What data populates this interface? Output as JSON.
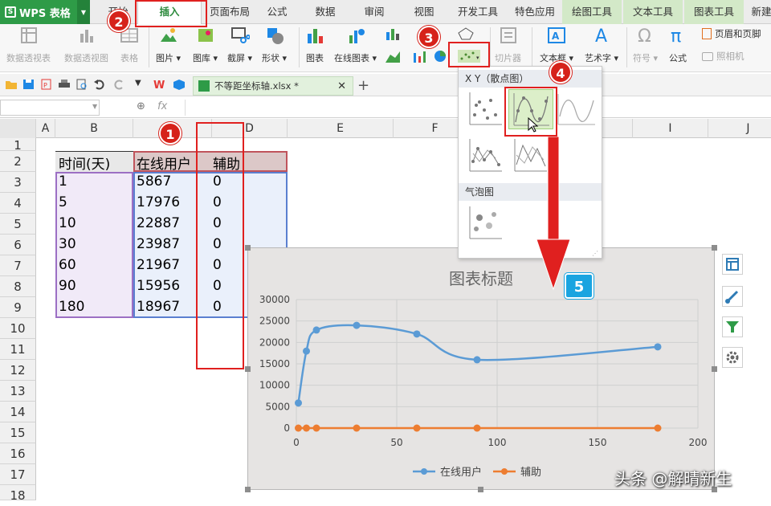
{
  "menubar": {
    "app_name": "WPS 表格",
    "tabs": [
      "开始",
      "插入",
      "页面布局",
      "公式",
      "数据",
      "审阅",
      "视图",
      "开发工具",
      "特色应用",
      "绘图工具",
      "文本工具",
      "图表工具",
      "新建"
    ],
    "active_tab": "插入"
  },
  "ribbon": {
    "pivot_table": "数据透视表",
    "pivot_chart": "数据透视图",
    "table": "表格",
    "picture": "图片",
    "gallery": "图库",
    "screenshot": "截屏",
    "shape": "形状",
    "chart": "图表",
    "online_chart": "在线图表",
    "slicer": "切片器",
    "textbox": "文本框",
    "wordart": "艺术字",
    "symbol": "符号",
    "formula": "公式",
    "header_footer": "页眉和页脚",
    "camera": "照相机"
  },
  "file": {
    "tab_name": "不等距坐标轴.xlsx *"
  },
  "formula_bar": {
    "fx": "fx"
  },
  "sheet": {
    "columns": [
      "A",
      "B",
      "C",
      "D",
      "E",
      "F",
      "G",
      "H",
      "I",
      "J"
    ],
    "rows": [
      "1",
      "2",
      "3",
      "4",
      "5",
      "6",
      "7",
      "8",
      "9",
      "10",
      "11",
      "12",
      "13",
      "14",
      "15",
      "16",
      "17",
      "18"
    ],
    "headers": [
      "时间(天)",
      "在线用户",
      "辅助"
    ],
    "data": [
      [
        "1",
        "5867",
        "0"
      ],
      [
        "5",
        "17976",
        "0"
      ],
      [
        "10",
        "22887",
        "0"
      ],
      [
        "30",
        "23987",
        "0"
      ],
      [
        "60",
        "21967",
        "0"
      ],
      [
        "90",
        "15956",
        "0"
      ],
      [
        "180",
        "18967",
        "0"
      ]
    ]
  },
  "dropdown": {
    "xy_section": "X Y（散点图）",
    "bubble_section": "气泡图"
  },
  "chart": {
    "title": "图表标题",
    "accent_blue": "#5b9bd5",
    "accent_orange": "#ed7d31"
  },
  "chart_data": {
    "type": "scatter",
    "title": "图表标题",
    "xlim": [
      0,
      200
    ],
    "ylim": [
      0,
      30000
    ],
    "x_ticks": [
      "0",
      "50",
      "100",
      "150",
      "200"
    ],
    "y_ticks": [
      "0",
      "5000",
      "10000",
      "15000",
      "20000",
      "25000",
      "30000"
    ],
    "x": [
      1,
      5,
      10,
      30,
      60,
      90,
      180
    ],
    "series": [
      {
        "name": "在线用户",
        "values": [
          5867,
          17976,
          22887,
          23987,
          21967,
          15956,
          18967
        ],
        "color": "#5b9bd5"
      },
      {
        "name": "辅助",
        "values": [
          0,
          0,
          0,
          0,
          0,
          0,
          0
        ],
        "color": "#ed7d31"
      }
    ],
    "grid": true,
    "legend": "bottom",
    "smooth": true
  },
  "annotations": {
    "badge1": "1",
    "badge2": "2",
    "badge3": "3",
    "badge4": "4",
    "badge5": "5"
  },
  "watermark": "头条 @解晴新生"
}
